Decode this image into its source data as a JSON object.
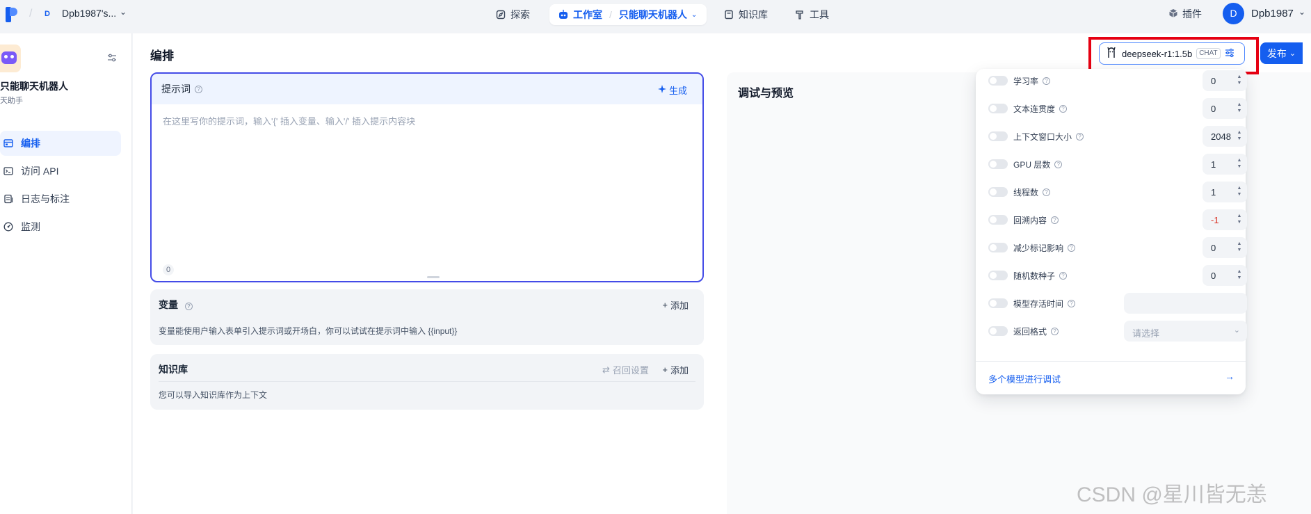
{
  "topbar": {
    "workspace_initial": "D",
    "workspace_name": "Dpb1987's...",
    "nav": {
      "explore": "探索",
      "studio": "工作室",
      "app_name": "只能聊天机器人",
      "knowledge": "知识库",
      "tools": "工具"
    },
    "plugins": "插件",
    "user_initial": "D",
    "user_name": "Dpb1987"
  },
  "sidebar": {
    "app_title": "只能聊天机器人",
    "app_subtitle": "天助手",
    "items": [
      {
        "label": "编排",
        "icon": "layout-icon",
        "active": true
      },
      {
        "label": "访问 API",
        "icon": "terminal-icon",
        "active": false
      },
      {
        "label": "日志与标注",
        "icon": "log-icon",
        "active": false
      },
      {
        "label": "监测",
        "icon": "gauge-icon",
        "active": false
      }
    ]
  },
  "main": {
    "title": "编排",
    "prompt": {
      "title": "提示词",
      "generate": "生成",
      "placeholder": "在这里写你的提示词，输入'{' 插入变量、输入'/' 插入提示内容块",
      "char_count": "0"
    },
    "variables": {
      "title": "变量",
      "add": "添加",
      "desc": "变量能使用户输入表单引入提示词或开场白，你可以试试在提示词中输入 {{input}}"
    },
    "knowledge": {
      "title": "知识库",
      "recall_settings": "召回设置",
      "add": "添加",
      "desc": "您可以导入知识库作为上下文"
    },
    "debug": {
      "title": "调试与预览"
    }
  },
  "model_selector": {
    "name": "deepseek-r1:1.5b",
    "badge": "CHAT",
    "publish": "发布"
  },
  "params": {
    "rows": [
      {
        "label": "学习率",
        "type": "number",
        "value": "0"
      },
      {
        "label": "文本连贯度",
        "type": "number",
        "value": "0"
      },
      {
        "label": "上下文窗口大小",
        "type": "number",
        "value": "2048"
      },
      {
        "label": "GPU 层数",
        "type": "number",
        "value": "1"
      },
      {
        "label": "线程数",
        "type": "number",
        "value": "1"
      },
      {
        "label": "回溯内容",
        "type": "number",
        "value": "-1"
      },
      {
        "label": "减少标记影响",
        "type": "number",
        "value": "0"
      },
      {
        "label": "随机数种子",
        "type": "number",
        "value": "0"
      },
      {
        "label": "模型存活时间",
        "type": "text",
        "value": ""
      },
      {
        "label": "返回格式",
        "type": "select",
        "placeholder": "请选择"
      }
    ],
    "multi_model": "多个模型进行调试"
  },
  "watermark": "CSDN @星川皆无恙",
  "colors": {
    "accent": "#155eef",
    "prompt_border": "#444ce7",
    "highlight": "#e60012"
  }
}
